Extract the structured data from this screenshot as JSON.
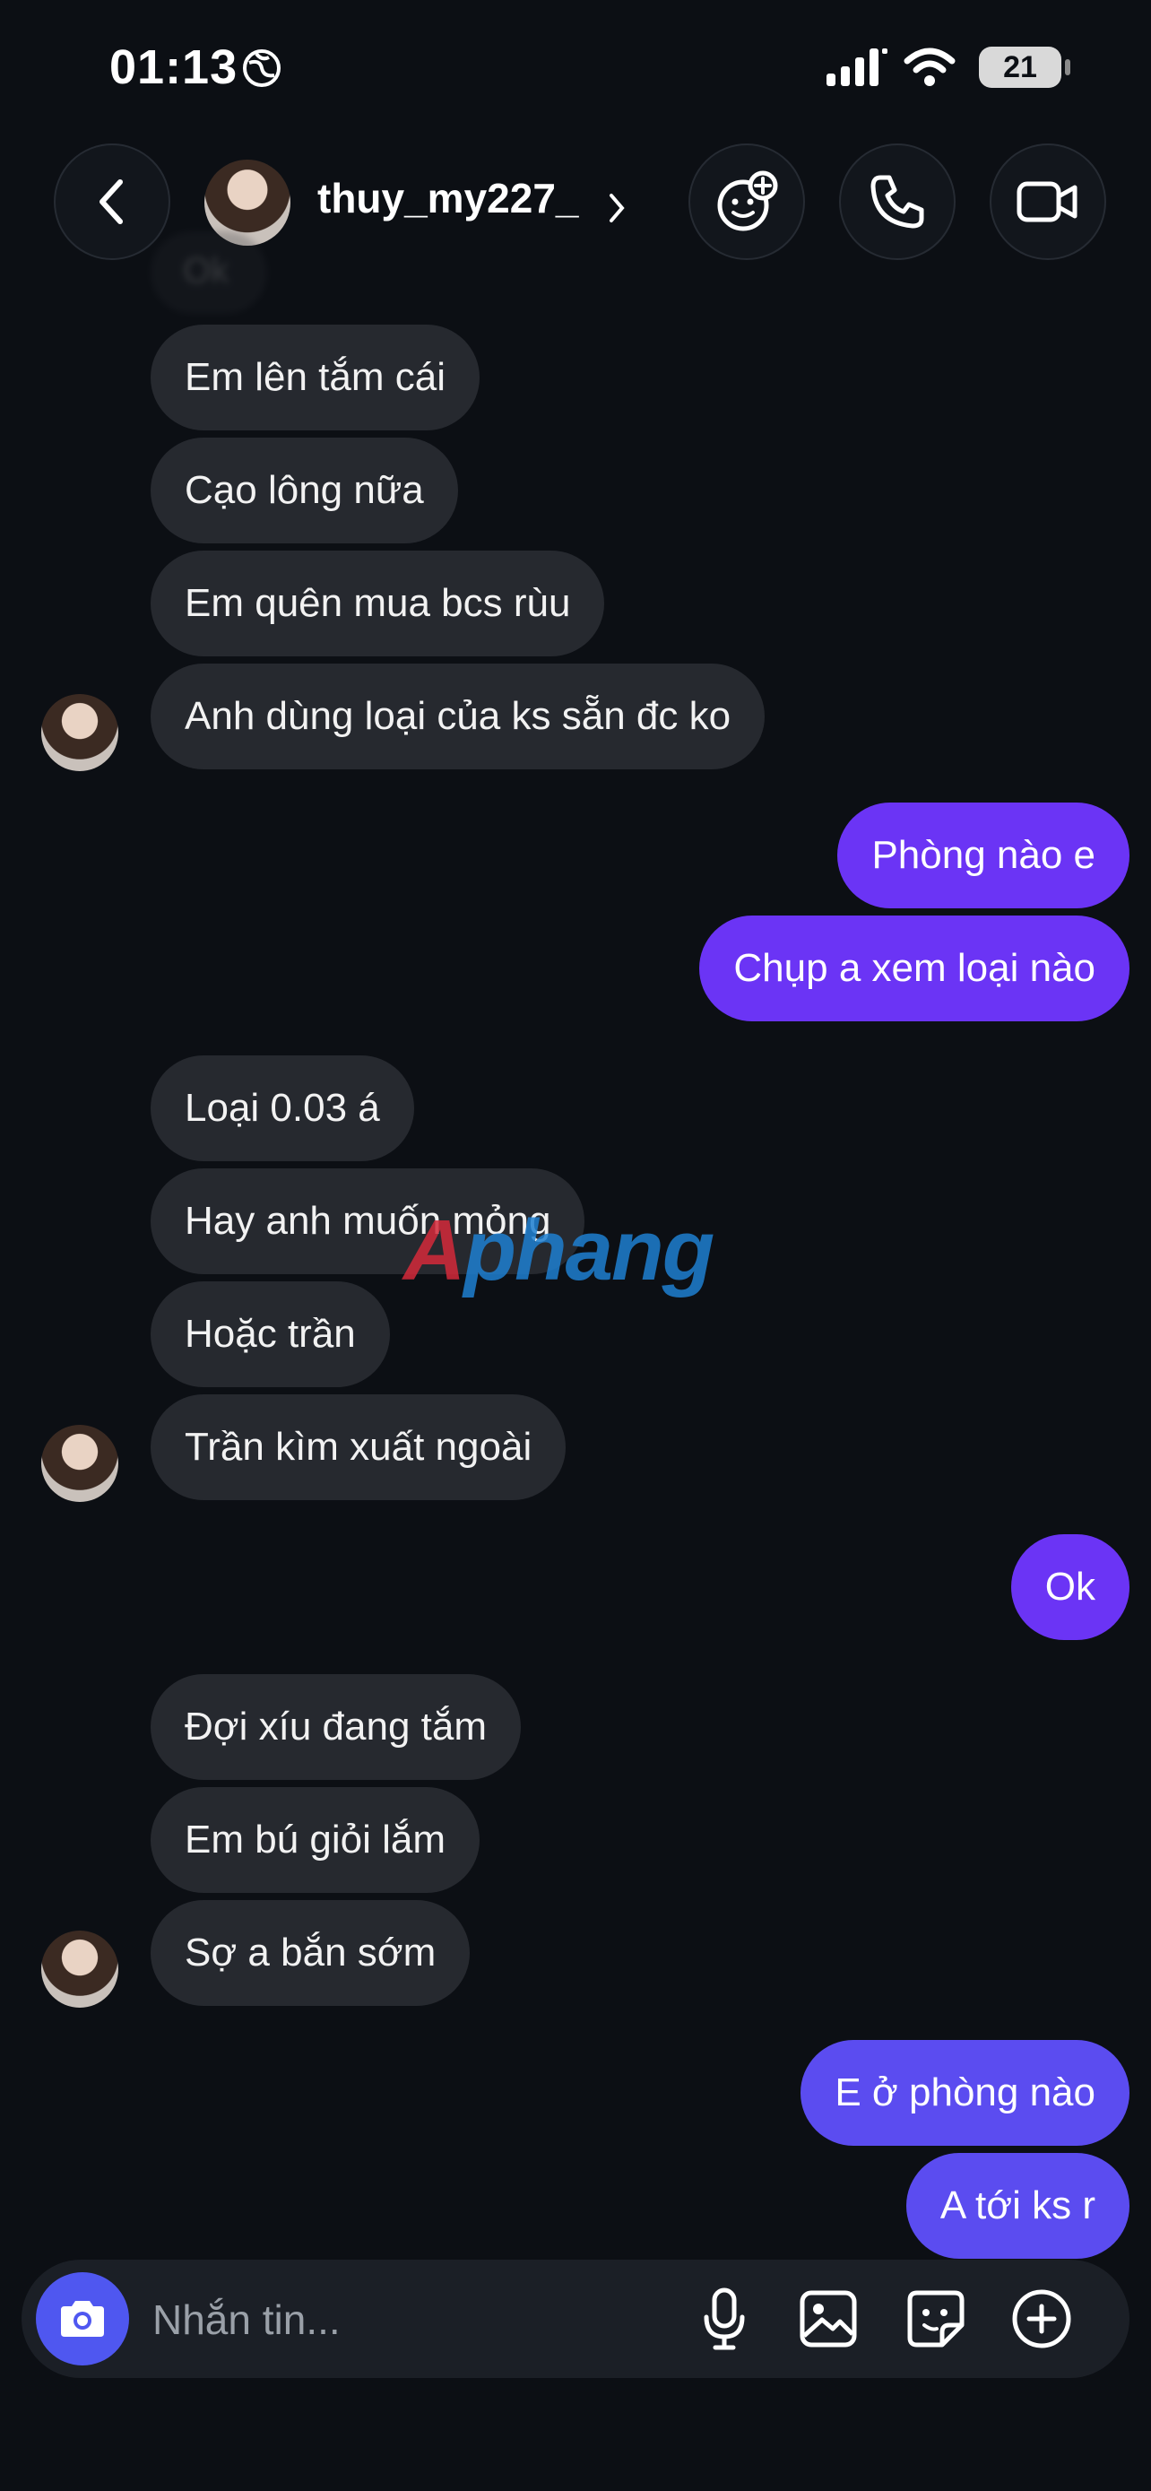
{
  "status_bar": {
    "time": "01:13",
    "battery": "21"
  },
  "header": {
    "username": "thuy_my227_"
  },
  "messages": [
    {
      "side": "received",
      "text": "Em lên tắm cái"
    },
    {
      "side": "received",
      "text": "Cạo lông nữa"
    },
    {
      "side": "received",
      "text": "Em quên mua bcs rùu"
    },
    {
      "side": "received",
      "text": "Anh dùng loại của ks sẵn đc ko"
    },
    {
      "side": "sent",
      "text": "Phòng nào e"
    },
    {
      "side": "sent",
      "text": "Chụp a xem loại nào"
    },
    {
      "side": "received",
      "text": "Loại 0.03 á"
    },
    {
      "side": "received",
      "text": "Hay anh muốn mỏng"
    },
    {
      "side": "received",
      "text": "Hoặc trần"
    },
    {
      "side": "received",
      "text": "Trần kìm xuất ngoài"
    },
    {
      "side": "sent",
      "text": "Ok"
    },
    {
      "side": "received",
      "text": "Đợi xíu đang tắm"
    },
    {
      "side": "received",
      "text": "Em bú giỏi lắm"
    },
    {
      "side": "received",
      "text": "Sợ a bắn sớm"
    },
    {
      "side": "sent",
      "text": "E ở phòng nào"
    },
    {
      "side": "sent",
      "text": "A tới ks r"
    }
  ],
  "faded_top_message": "Ok",
  "watermark": {
    "part1": "A",
    "part2": "phang"
  },
  "composer": {
    "placeholder": "Nhắn tin..."
  },
  "icons": [
    "back-icon",
    "profile-avatar",
    "chevron-right-icon",
    "effects-icon",
    "phone-icon",
    "video-icon",
    "camera-icon",
    "microphone-icon",
    "gallery-icon",
    "sticker-icon",
    "plus-icon",
    "globe-icon",
    "signal-icon",
    "wifi-icon",
    "battery-icon"
  ],
  "colors": {
    "background": "#0c0f14",
    "received_bubble": "#26292f",
    "sent_bubble": "#6b34f5",
    "sent_bubble_bottom": "#5b4cf0",
    "camera_button": "#4f57f0"
  }
}
